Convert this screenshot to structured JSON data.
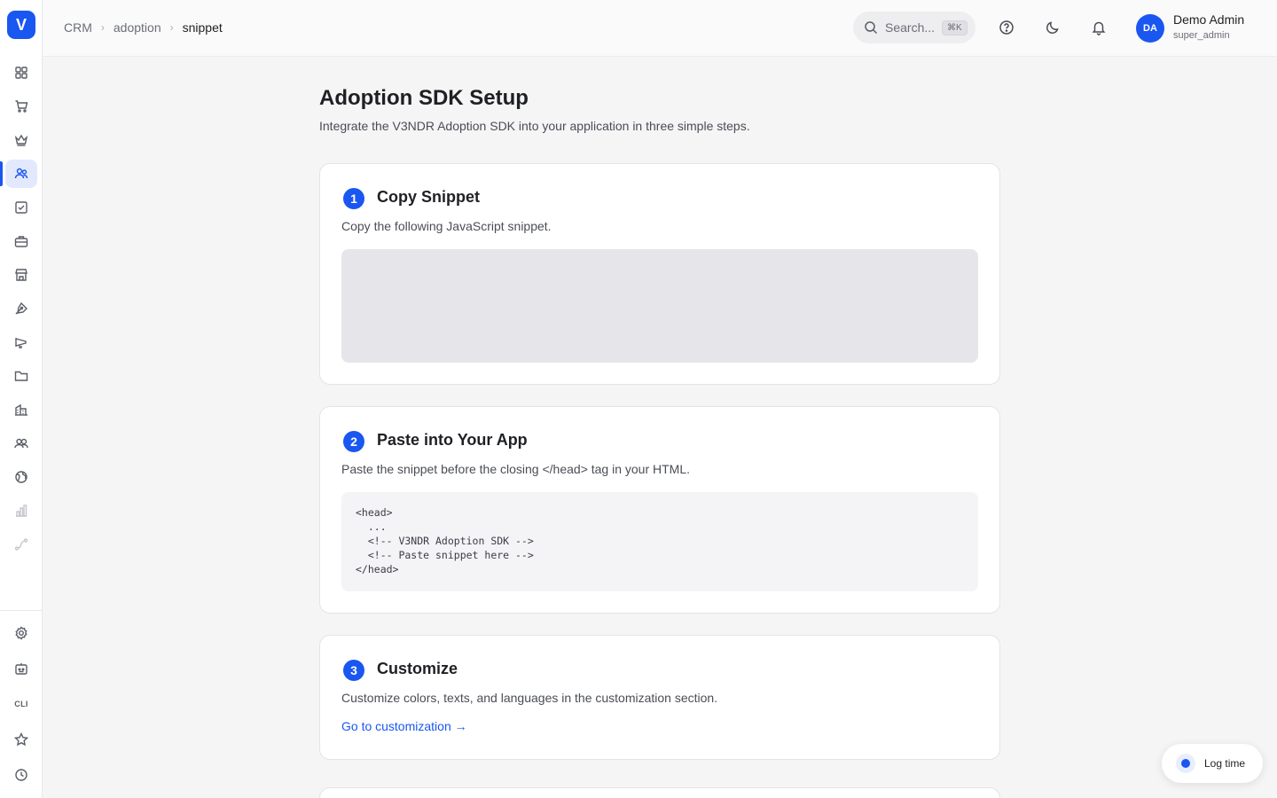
{
  "sidebar": {
    "logo_letter": "V",
    "items": [
      {
        "icon": "dashboard-grid-icon"
      },
      {
        "icon": "shopping-cart-icon"
      },
      {
        "icon": "crown-icon"
      },
      {
        "icon": "users-icon",
        "active": true
      },
      {
        "icon": "checkbox-icon"
      },
      {
        "icon": "briefcase-icon"
      },
      {
        "icon": "store-icon"
      },
      {
        "icon": "pen-tool-icon"
      },
      {
        "icon": "megaphone-icon"
      },
      {
        "icon": "folder-icon"
      },
      {
        "icon": "building-icon"
      },
      {
        "icon": "team-icon"
      },
      {
        "icon": "globe-icon"
      },
      {
        "icon": "bar-chart-icon"
      },
      {
        "icon": "route-icon"
      }
    ],
    "bottom_items": [
      {
        "icon": "settings-icon"
      },
      {
        "icon": "bot-icon"
      },
      {
        "icon": "cli-icon",
        "label": "CLI"
      },
      {
        "icon": "star-icon"
      },
      {
        "icon": "clock-icon"
      }
    ]
  },
  "header": {
    "breadcrumb": [
      "CRM",
      "adoption",
      "snippet"
    ],
    "search_placeholder": "Search...",
    "search_shortcut": "⌘K",
    "user": {
      "initials": "DA",
      "name": "Demo Admin",
      "role": "super_admin"
    }
  },
  "main": {
    "title": "Adoption SDK Setup",
    "subtitle": "Integrate the V3NDR Adoption SDK into your application in three simple steps.",
    "steps": [
      {
        "number": "1",
        "title": "Copy Snippet",
        "description": "Copy the following JavaScript snippet."
      },
      {
        "number": "2",
        "title": "Paste into Your App",
        "description": "Paste the snippet before the closing </head> tag in your HTML.",
        "code": "<head>\n  ...\n  <!-- V3NDR Adoption SDK -->\n  <!-- Paste snippet here -->\n</head>"
      },
      {
        "number": "3",
        "title": "Customize",
        "description": "Customize colors, texts, and languages in the customization section.",
        "link": "Go to customization →"
      }
    ]
  },
  "log_time_label": "Log time",
  "colors": {
    "accent": "#1a56f0"
  }
}
